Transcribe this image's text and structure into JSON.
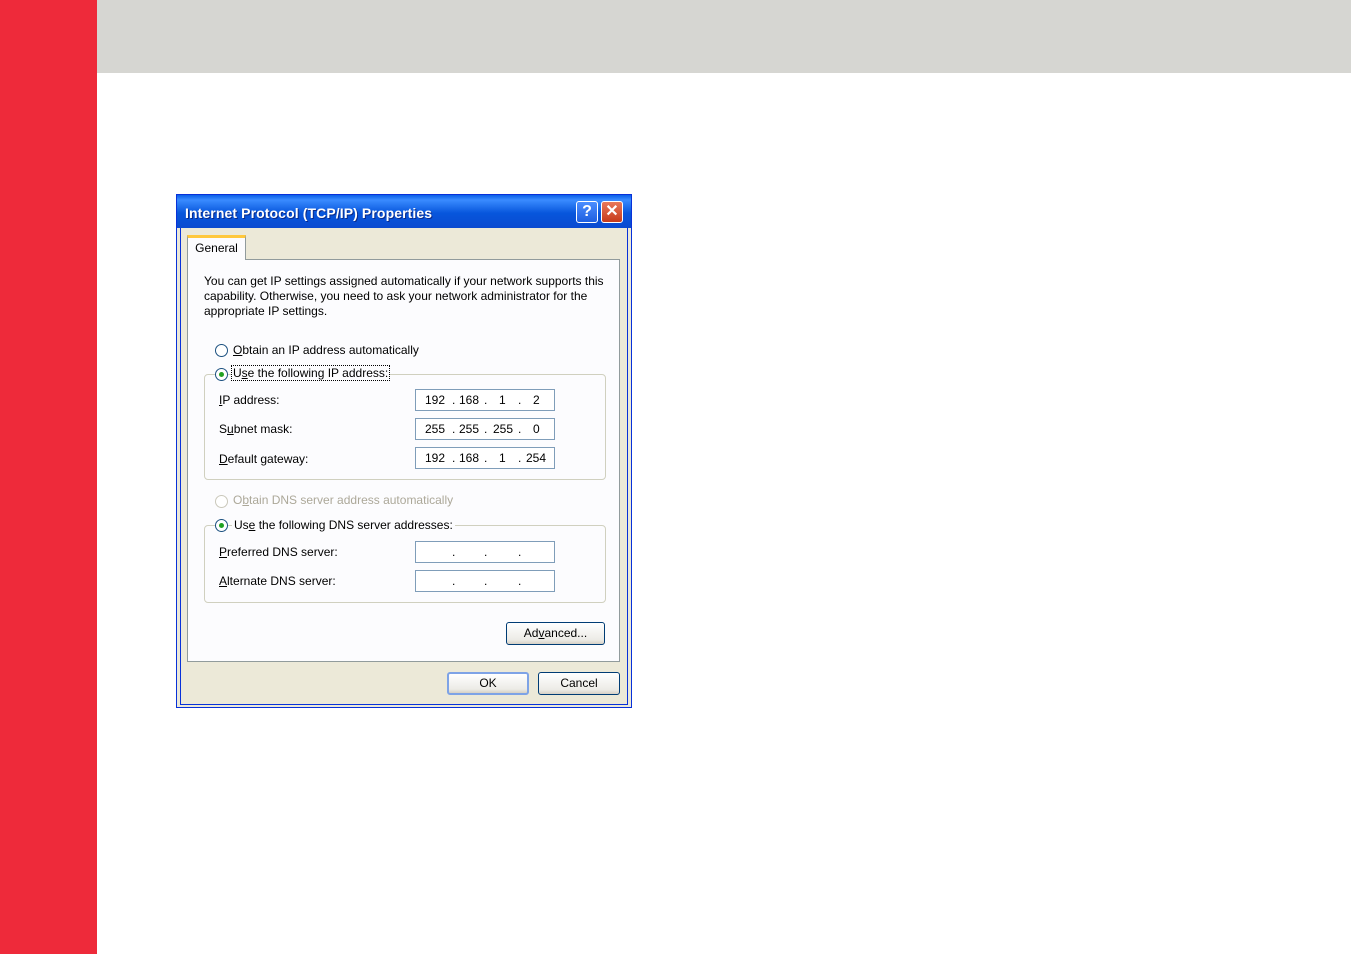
{
  "dialog": {
    "title": "Internet Protocol (TCP/IP) Properties",
    "help_label": "?",
    "close_label": "✕"
  },
  "tab": {
    "label": "General"
  },
  "description": "You can get IP settings assigned automatically if your network supports this capability. Otherwise, you need to ask your network administrator for the appropriate IP settings.",
  "ip_mode": {
    "auto": {
      "pre": "",
      "key": "O",
      "post": "btain an IP address automatically",
      "selected": false
    },
    "manual": {
      "pre": "U",
      "key": "s",
      "post": "e the following IP address:",
      "selected": true
    }
  },
  "ip_fields": [
    {
      "pre": "",
      "key": "I",
      "post": "P address:",
      "octets": [
        "192",
        "168",
        "1",
        "2"
      ]
    },
    {
      "pre": "S",
      "key": "u",
      "post": "bnet mask:",
      "octets": [
        "255",
        "255",
        "255",
        "0"
      ]
    },
    {
      "pre": "",
      "key": "D",
      "post": "efault gateway:",
      "octets": [
        "192",
        "168",
        "1",
        "254"
      ]
    }
  ],
  "dns_mode": {
    "auto": {
      "pre": "O",
      "key": "b",
      "post": "tain DNS server address automatically",
      "selected": false,
      "disabled": true
    },
    "manual": {
      "pre": "Us",
      "key": "e",
      "post": " the following DNS server addresses:",
      "selected": true
    }
  },
  "dns_fields": [
    {
      "pre": "",
      "key": "P",
      "post": "referred DNS server:",
      "octets": [
        "",
        "",
        "",
        ""
      ]
    },
    {
      "pre": "",
      "key": "A",
      "post": "lternate DNS server:",
      "octets": [
        "",
        "",
        "",
        ""
      ]
    }
  ],
  "separator": ".",
  "buttons": {
    "advanced": {
      "pre": "Ad",
      "key": "v",
      "post": "anced..."
    },
    "ok": "OK",
    "cancel": "Cancel"
  },
  "colors": {
    "side_bar": "#ee2a3a",
    "top_band": "#d6d6d2",
    "titlebar": "#0756dc",
    "dialog_face": "#ece9d8",
    "tab_accent": "#ffc83c"
  }
}
